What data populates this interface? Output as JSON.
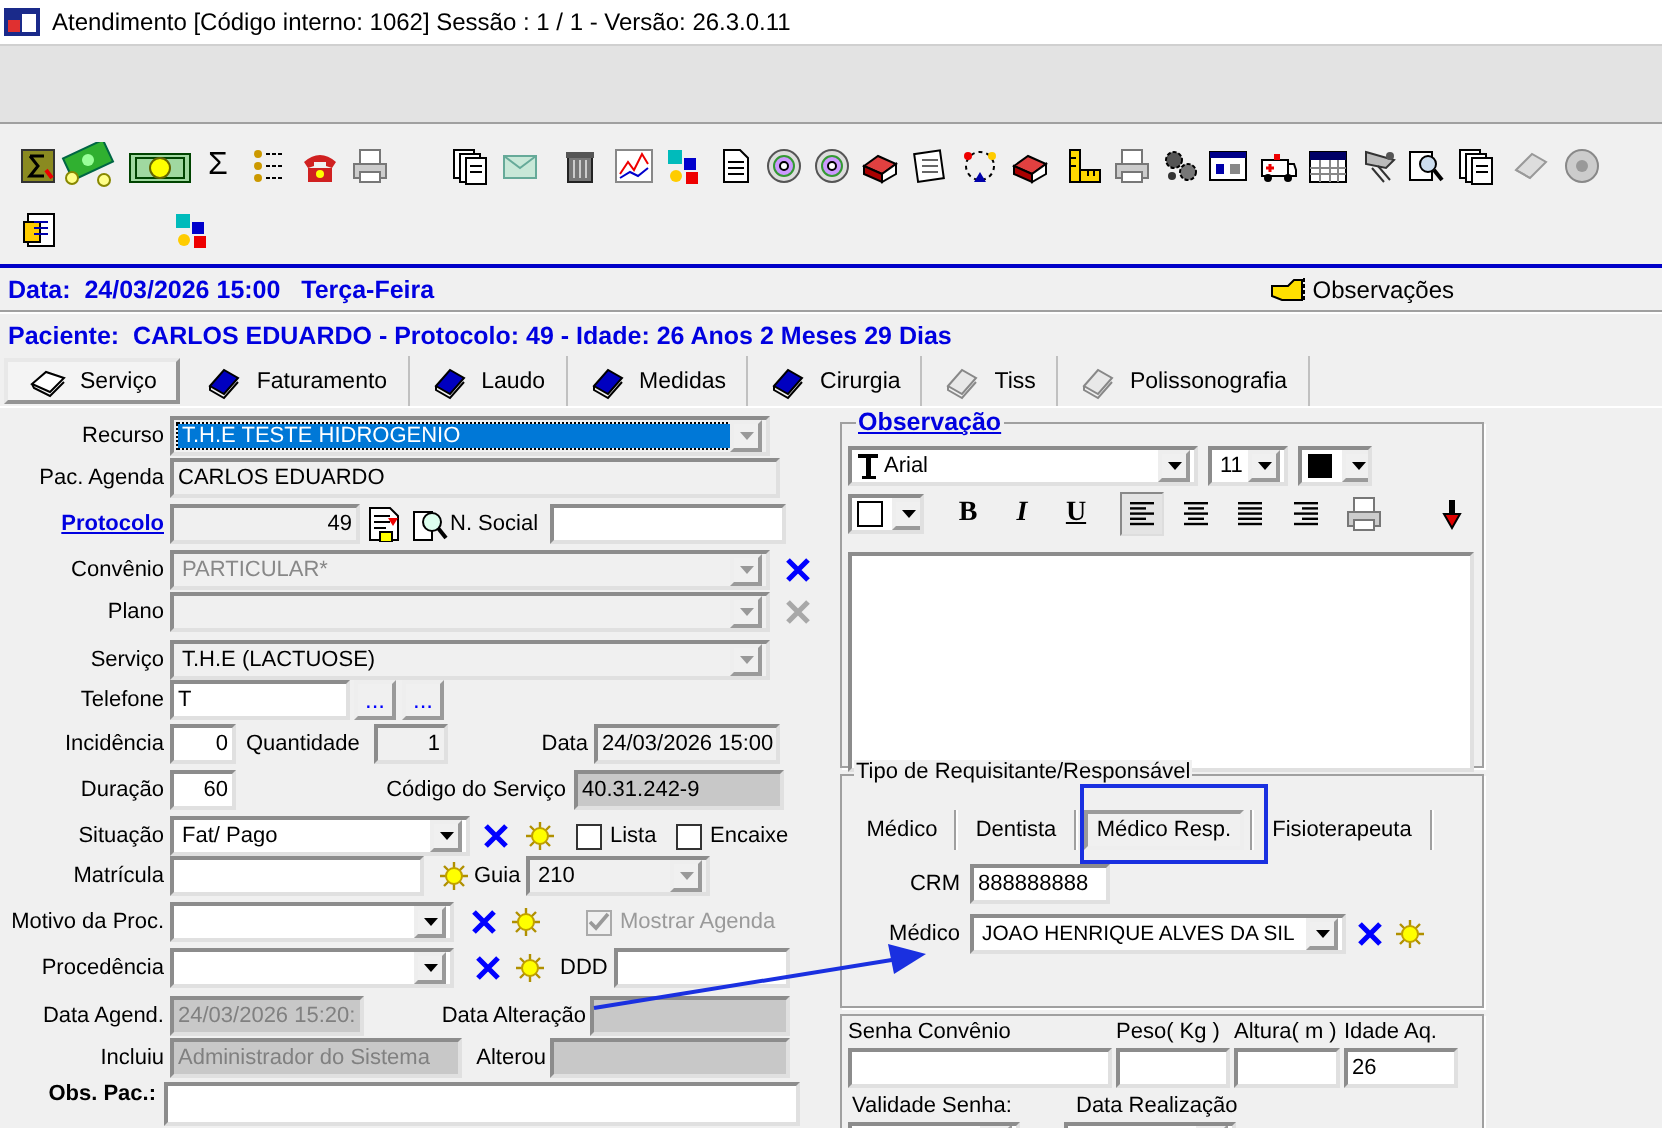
{
  "window": {
    "title": "Atendimento [Código interno: 1062]  Sessão : 1 / 1 - Versão: 26.3.0.11"
  },
  "toolbar": {
    "glyph": "Σ"
  },
  "header": {
    "date_line": "Data:  24/03/2026 15:00   Terça-Feira",
    "notes_button": "Observações",
    "patient_line": "Paciente:  CARLOS EDUARDO - Protocolo: 49 - Idade: 26 Anos 2 Meses 29 Dias"
  },
  "tabs": [
    {
      "label": "Serviço",
      "selected": true,
      "disabled": false
    },
    {
      "label": "Faturamento",
      "selected": false,
      "disabled": false
    },
    {
      "label": "Laudo",
      "selected": false,
      "disabled": false
    },
    {
      "label": "Medidas",
      "selected": false,
      "disabled": false
    },
    {
      "label": "Cirurgia",
      "selected": false,
      "disabled": false
    },
    {
      "label": "Tiss",
      "selected": false,
      "disabled": true
    },
    {
      "label": "Polissonografia",
      "selected": false,
      "disabled": true
    }
  ],
  "service_form": {
    "rows": [
      {
        "items": [
          {
            "kind": "label",
            "text": "Recurso"
          },
          {
            "kind": "combo",
            "value": "T.H.E  TESTE HIDROGENIO",
            "readonly": true,
            "selected": true
          }
        ]
      },
      {
        "items": [
          {
            "kind": "label",
            "text": "Pac. Agenda"
          },
          {
            "kind": "input",
            "value": "CARLOS EDUARDO",
            "readonly": true
          }
        ]
      },
      {
        "items": [
          {
            "kind": "link",
            "text": "Protocolo"
          },
          {
            "kind": "input",
            "value": "49",
            "readonly": true
          },
          {
            "kind": "doc"
          },
          {
            "kind": "search"
          },
          {
            "kind": "label",
            "text": "N. Social"
          },
          {
            "kind": "input"
          }
        ]
      },
      {
        "items": [
          {
            "kind": "label",
            "text": "Convênio"
          },
          {
            "kind": "combo",
            "value": "PARTICULAR*",
            "disabled": true
          },
          {
            "kind": "clear",
            "disabled": false
          }
        ]
      },
      {
        "items": [
          {
            "kind": "label",
            "text": "Plano"
          },
          {
            "kind": "combo",
            "disabled": true
          },
          {
            "kind": "clear",
            "disabled": true
          }
        ]
      },
      {
        "items": [
          {
            "kind": "label",
            "text": "Serviço"
          },
          {
            "kind": "combo",
            "value": "T.H.E (LACTUOSE)",
            "readonly": true
          }
        ]
      },
      {
        "items": [
          {
            "kind": "label",
            "text": "Telefone"
          },
          {
            "kind": "input",
            "value": "T"
          },
          {
            "kind": "dots",
            "text": "..."
          },
          {
            "kind": "dots",
            "text": "..."
          }
        ]
      },
      {
        "items": [
          {
            "kind": "label",
            "text": "Incidência"
          },
          {
            "kind": "input",
            "value": "0"
          },
          {
            "kind": "label",
            "text": "Quantidade"
          },
          {
            "kind": "input",
            "value": "1",
            "readonly": true
          },
          {
            "kind": "label",
            "text": "Data"
          },
          {
            "kind": "input",
            "value": "24/03/2026 15:00",
            "readonly": true
          }
        ]
      },
      {
        "items": [
          {
            "kind": "label",
            "text": "Duração"
          },
          {
            "kind": "input",
            "value": "60"
          },
          {
            "kind": "label",
            "text": "Código do Serviço"
          },
          {
            "kind": "input",
            "value": "40.31.242-9",
            "locked": true
          }
        ]
      },
      {
        "items": [
          {
            "kind": "label",
            "text": "Situação"
          },
          {
            "kind": "combo",
            "value": "Fat/ Pago"
          },
          {
            "kind": "clear",
            "disabled": false
          },
          {
            "kind": "new"
          },
          {
            "kind": "checkbox",
            "text": "Lista",
            "checked": false,
            "disabled": false
          },
          {
            "kind": "checkbox",
            "text": "Encaixe",
            "checked": false,
            "disabled": false
          }
        ]
      },
      {
        "items": [
          {
            "kind": "label",
            "text": "Matrícula"
          },
          {
            "kind": "input"
          },
          {
            "kind": "new"
          },
          {
            "kind": "label",
            "text": "Guia"
          },
          {
            "kind": "combo",
            "value": "210",
            "readonly": true
          }
        ]
      },
      {
        "items": [
          {
            "kind": "label",
            "text": "Motivo da Proc."
          },
          {
            "kind": "combo"
          },
          {
            "kind": "clear",
            "disabled": false
          },
          {
            "kind": "new"
          },
          {
            "kind": "checkbox",
            "text": "Mostrar Agenda",
            "checked": true,
            "disabled": true
          }
        ]
      },
      {
        "items": [
          {
            "kind": "label",
            "text": "Procedência"
          },
          {
            "kind": "combo"
          },
          {
            "kind": "clear",
            "disabled": false
          },
          {
            "kind": "new"
          },
          {
            "kind": "label",
            "text": "DDD"
          },
          {
            "kind": "input"
          }
        ]
      },
      {
        "items": [
          {
            "kind": "label",
            "text": "Data Agend."
          },
          {
            "kind": "input",
            "value": "24/03/2026 15:20:",
            "disabled": true
          },
          {
            "kind": "label",
            "text": "Data Alteração"
          },
          {
            "kind": "input",
            "disabled": true
          }
        ]
      },
      {
        "items": [
          {
            "kind": "label",
            "text": "Incluiu"
          },
          {
            "kind": "input",
            "value": "Administrador do Sistema",
            "disabled": true
          },
          {
            "kind": "label",
            "text": "Alterou"
          },
          {
            "kind": "input",
            "disabled": true
          }
        ]
      },
      {
        "items": [
          {
            "kind": "bold",
            "text": "Obs. Pac.:"
          },
          {
            "kind": "textarea"
          }
        ]
      }
    ]
  },
  "observation": {
    "title": "Observação",
    "font": "Arial",
    "size": "11",
    "format_buttons": [
      {
        "label": "B",
        "kind": "bold"
      },
      {
        "label": "I",
        "kind": "italic"
      },
      {
        "label": "U",
        "kind": "underline"
      }
    ],
    "align_buttons": [
      {
        "kind": "left",
        "selected": true
      },
      {
        "kind": "center",
        "selected": false
      },
      {
        "kind": "justify",
        "selected": false
      },
      {
        "kind": "right",
        "selected": false
      }
    ]
  },
  "requester": {
    "title": "Tipo de Requisitante/Responsável",
    "tabs": [
      {
        "label": "Médico",
        "selected": false
      },
      {
        "label": "Dentista",
        "selected": false
      },
      {
        "label": "Médico Resp.",
        "selected": true
      },
      {
        "label": "Fisioterapeuta",
        "selected": false
      }
    ],
    "crm_label": "CRM",
    "crm": "888888888",
    "doctor_label": "Médico",
    "doctor": "JOAO HENRIQUE ALVES DA SIL"
  },
  "authorization": {
    "fields": [
      {
        "label": "Senha Convênio"
      },
      {
        "label": "Peso( Kg )"
      },
      {
        "label": "Altura( m )"
      },
      {
        "label": "Idade Aq.",
        "value": "26"
      }
    ],
    "second_row": [
      {
        "label": "Validade Senha:"
      },
      {
        "label": "Data Realização"
      }
    ]
  }
}
